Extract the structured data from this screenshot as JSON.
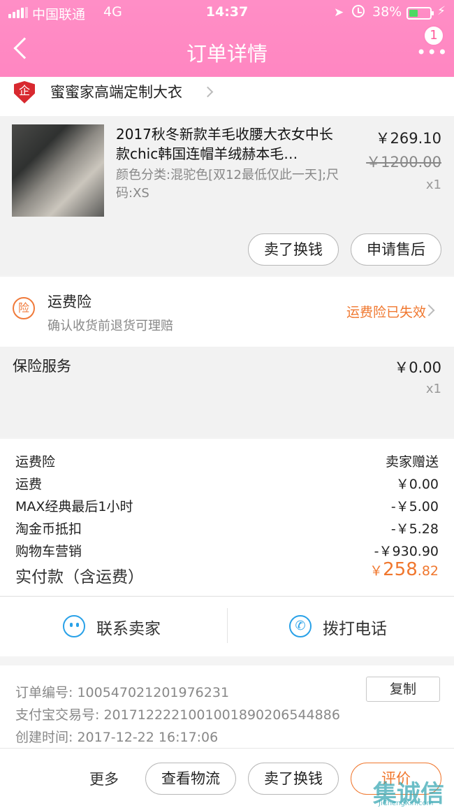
{
  "status_bar": {
    "carrier": "中国联通",
    "network": "4G",
    "time": "14:37",
    "battery": "38%"
  },
  "nav": {
    "title": "订单详情",
    "more_badge": "1"
  },
  "shop": {
    "badge_char": "企",
    "name": "蜜蜜家高端定制大衣"
  },
  "product": {
    "title": "2017秋冬新款羊毛收腰大衣女中长款chic韩国连帽羊绒赫本毛…",
    "spec": "颜色分类:混驼色[双12最低仅此一天];尺码:XS",
    "price": "￥269.10",
    "original_price": "￥1200.00",
    "quantity": "x1",
    "actions": [
      "卖了换钱",
      "申请售后"
    ]
  },
  "freight_insurance": {
    "icon_char": "险",
    "title": "运费险",
    "description": "确认收货前退货可理赔",
    "status": "运费险已失效"
  },
  "insurance_service": {
    "title": "保险服务",
    "price": "￥0.00",
    "quantity": "x1"
  },
  "summary": {
    "rows": [
      {
        "label": "运费险",
        "value": "卖家赠送"
      },
      {
        "label": "运费",
        "value": "￥0.00"
      },
      {
        "label": "MAX经典最后1小时",
        "value": "-￥5.00"
      },
      {
        "label": "淘金币抵扣",
        "value": "-￥5.28"
      },
      {
        "label": "购物车营销",
        "value": "-￥930.90"
      }
    ],
    "total_label": "实付款（含运费）",
    "total_currency": "￥",
    "total_int": "258",
    "total_cents": ".82"
  },
  "contact": {
    "seller_label": "联系卖家",
    "call_label": "拨打电话"
  },
  "order_info": {
    "order_no": "订单编号:  100547021201976231",
    "alipay_no": "支付宝交易号:  2017122221001001890206544886",
    "created": "创建时间:   2017-12-22 16:17:06",
    "copy_label": "复制"
  },
  "bottom_bar": {
    "more": "更多",
    "buttons": [
      "查看物流",
      "卖了换钱",
      "评价"
    ]
  },
  "watermark": {
    "logo": "集诚信",
    "url": "JiChengXin.com"
  },
  "colors": {
    "header_pink": "#ff86c1",
    "accent_orange": "#f0772e",
    "link_blue": "#29a1e8",
    "shop_red": "#d8292f"
  }
}
